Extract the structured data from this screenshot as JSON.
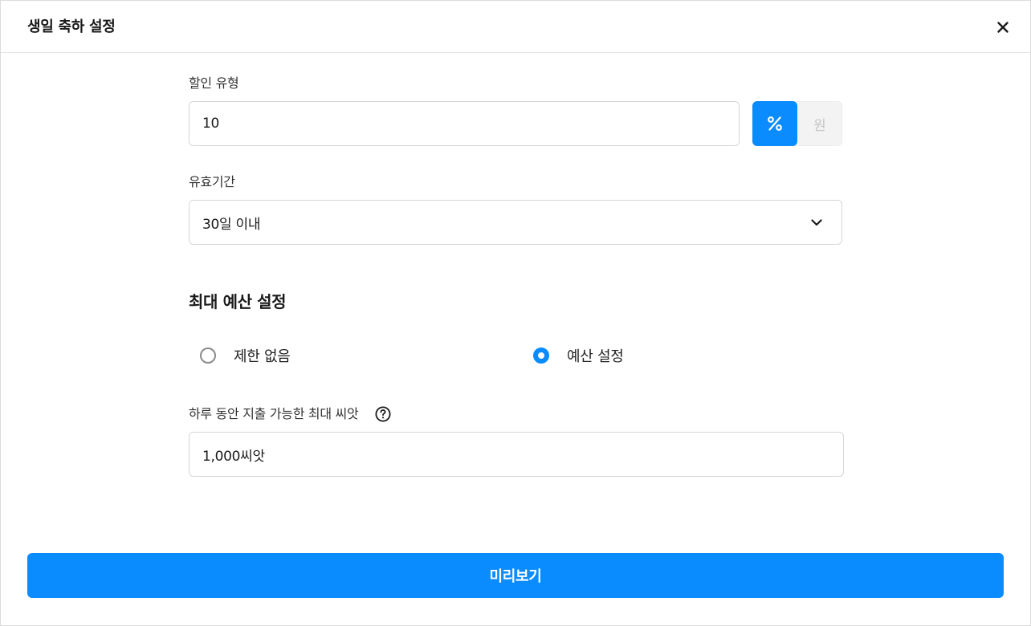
{
  "modal": {
    "title": "생일 축하 설정",
    "close_icon": "close-icon"
  },
  "discount": {
    "label": "할인 유형",
    "value": "10",
    "unit_options": [
      {
        "label": "%",
        "selected": true
      },
      {
        "label": "원",
        "selected": false
      }
    ]
  },
  "validity": {
    "label": "유효기간",
    "selected": "30일 이내",
    "icon": "chevron-down-icon"
  },
  "budget": {
    "section_title": "최대 예산 설정",
    "options": [
      {
        "label": "제한 없음",
        "checked": false
      },
      {
        "label": "예산 설정",
        "checked": true
      }
    ],
    "daily_label": "하루 동안 지출 가능한 최대 씨앗",
    "help_icon": "help-circle-icon",
    "daily_value": "1,000씨앗"
  },
  "footer": {
    "preview_label": "미리보기"
  },
  "colors": {
    "accent": "#0a8cff",
    "border": "#d6d6d6",
    "muted": "#c4c4c4"
  }
}
